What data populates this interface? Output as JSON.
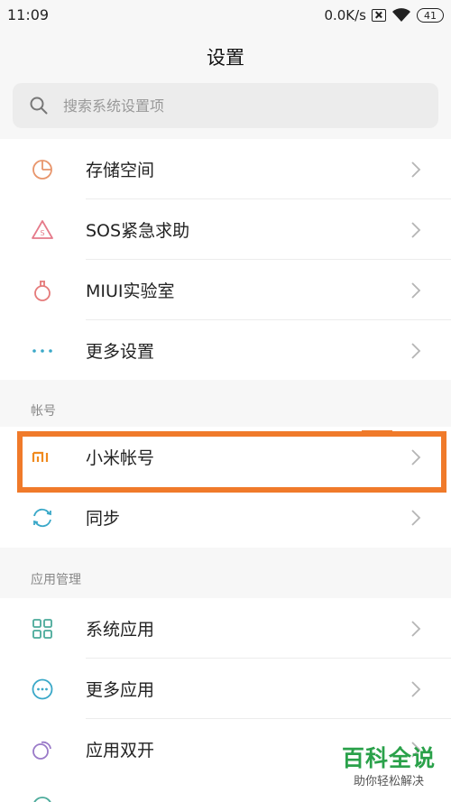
{
  "status_bar": {
    "time": "11:09",
    "speed": "0.0K/s",
    "battery": "41"
  },
  "page": {
    "title": "设置"
  },
  "search": {
    "placeholder": "搜索系统设置项"
  },
  "groups": [
    {
      "label": "",
      "items": [
        {
          "label": "存储空间",
          "icon": "storage-pie-icon",
          "color": "#e8956b"
        },
        {
          "label": "SOS紧急求助",
          "icon": "sos-warning-icon",
          "color": "#e57a8a"
        },
        {
          "label": "MIUI实验室",
          "icon": "flask-icon",
          "color": "#e57a7a"
        },
        {
          "label": "更多设置",
          "icon": "more-dots-icon",
          "color": "#3aa8c8"
        }
      ]
    },
    {
      "label": "帐号",
      "items": [
        {
          "label": "小米帐号",
          "icon": "mi-logo-icon",
          "color": "#f08a1e"
        },
        {
          "label": "同步",
          "icon": "sync-icon",
          "color": "#3aa8c8"
        }
      ]
    },
    {
      "label": "应用管理",
      "items": [
        {
          "label": "系统应用",
          "icon": "grid-apps-icon",
          "color": "#4aaa9a"
        },
        {
          "label": "更多应用",
          "icon": "more-apps-icon",
          "color": "#3aa8c8"
        },
        {
          "label": "应用双开",
          "icon": "dual-apps-icon",
          "color": "#9a7ac8"
        }
      ]
    }
  ],
  "watermark": {
    "main": "百科全说",
    "sub": "助你轻松解决"
  },
  "colors": {
    "highlight": "#f07a2a",
    "watermark": "#2aa14a"
  }
}
